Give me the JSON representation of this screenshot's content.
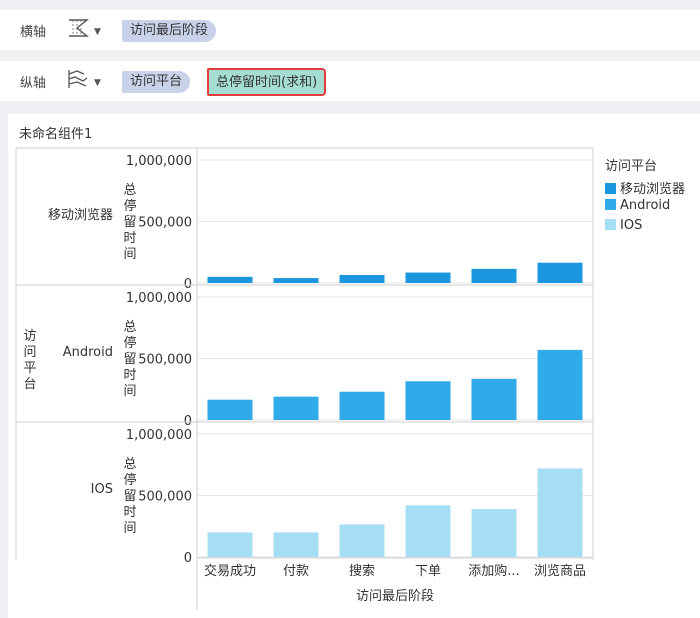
{
  "x_shelf": {
    "label": "横轴",
    "field": "访问最后阶段"
  },
  "y_shelf": {
    "label": "纵轴",
    "fields": [
      "访问平台",
      "总停留时间(求和)"
    ]
  },
  "panel_title": "未命名组件1",
  "legend": {
    "title": "访问平台",
    "items": [
      {
        "label": "移动浏览器",
        "color": "#1a97de"
      },
      {
        "label": "Android",
        "color": "#31aaea"
      },
      {
        "label": "IOS",
        "color": "#a6dff5"
      }
    ]
  },
  "chart_data": {
    "type": "bar",
    "title": "",
    "xlabel": "访问最后阶段",
    "ylabel": "总停留时间",
    "facet_label": "访问平台",
    "categories": [
      "交易成功",
      "付款",
      "搜索",
      "下单",
      "添加购...",
      "浏览商品"
    ],
    "ylim": [
      0,
      1000000
    ],
    "yticks": [
      "0",
      "500,000",
      "1,000,000"
    ],
    "series": [
      {
        "name": "移动浏览器",
        "color": "#1a97de",
        "values": [
          50000,
          40000,
          65000,
          85000,
          115000,
          165000
        ]
      },
      {
        "name": "Android",
        "color": "#31aaea",
        "values": [
          165000,
          190000,
          230000,
          315000,
          335000,
          570000
        ]
      },
      {
        "name": "IOS",
        "color": "#a6dff5",
        "values": [
          200000,
          200000,
          265000,
          420000,
          390000,
          720000
        ]
      }
    ]
  }
}
